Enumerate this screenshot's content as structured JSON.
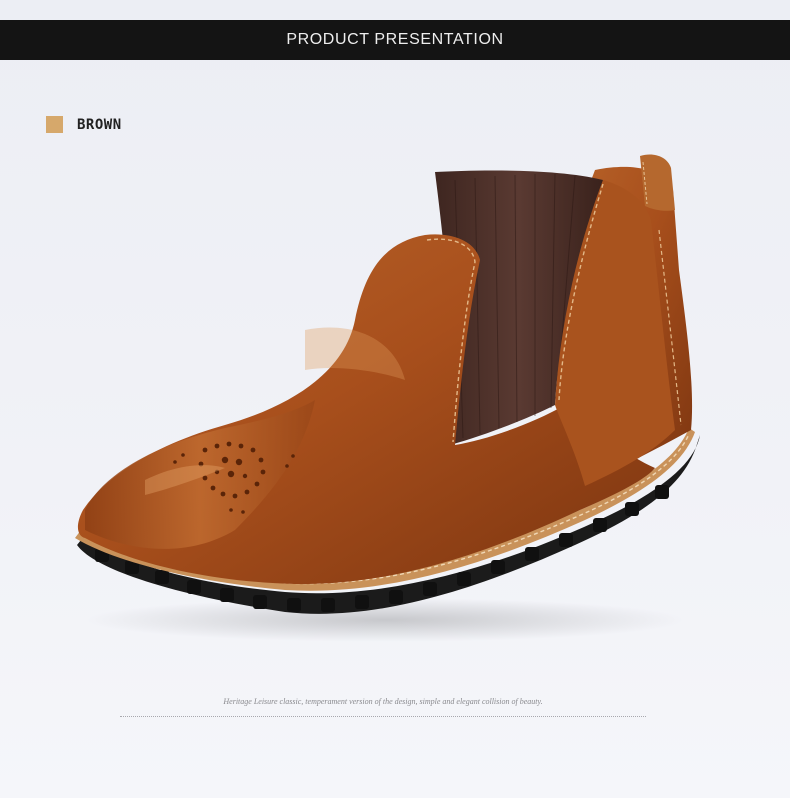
{
  "header": {
    "title": "PRODUCT PRESENTATION"
  },
  "color_option": {
    "label": "BROWN",
    "swatch_color": "#d6a86b"
  },
  "product": {
    "image": "brown-chelsea-boot"
  },
  "caption": {
    "text": "Heritage Leisure classic, temperament version of the design, simple and elegant collision of beauty."
  }
}
